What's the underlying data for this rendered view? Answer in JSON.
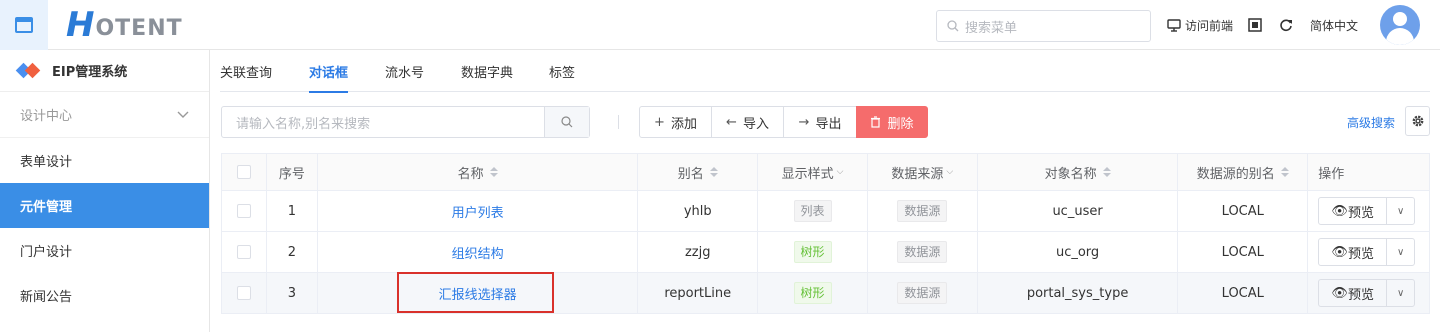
{
  "header": {
    "logo_h": "H",
    "logo_rest": "OTENT",
    "search_placeholder": "搜索菜单",
    "visit_frontend": "访问前端",
    "language": "简体中文"
  },
  "sidebar": {
    "system_title": "EIP管理系统",
    "group_label": "设计中心",
    "items": [
      {
        "label": "表单设计",
        "active": false
      },
      {
        "label": "元件管理",
        "active": true
      },
      {
        "label": "门户设计",
        "active": false
      },
      {
        "label": "新闻公告",
        "active": false
      }
    ]
  },
  "tabs": [
    {
      "label": "关联查询",
      "active": false
    },
    {
      "label": "对话框",
      "active": true
    },
    {
      "label": "流水号",
      "active": false
    },
    {
      "label": "数据字典",
      "active": false
    },
    {
      "label": "标签",
      "active": false
    }
  ],
  "toolbar": {
    "search_placeholder": "请输入名称,别名来搜索",
    "add_label": "添加",
    "import_label": "导入",
    "export_label": "导出",
    "delete_label": "删除",
    "advanced_search": "高级搜索"
  },
  "table": {
    "columns": {
      "no": "序号",
      "name": "名称",
      "alias": "别名",
      "style": "显示样式",
      "source": "数据来源",
      "object": "对象名称",
      "source_alias": "数据源的别名",
      "operation": "操作"
    },
    "rows": [
      {
        "no": "1",
        "name": "用户列表",
        "alias": "yhlb",
        "style": "列表",
        "source": "数据源",
        "object": "uc_user",
        "source_alias": "LOCAL",
        "action": "预览"
      },
      {
        "no": "2",
        "name": "组织结构",
        "alias": "zzjg",
        "style": "树形",
        "source": "数据源",
        "object": "uc_org",
        "source_alias": "LOCAL",
        "action": "预览"
      },
      {
        "no": "3",
        "name": "汇报线选择器",
        "alias": "reportLine",
        "style": "树形",
        "source": "数据源",
        "object": "portal_sys_type",
        "source_alias": "LOCAL",
        "action": "预览"
      }
    ]
  },
  "colors": {
    "primary": "#2c7be5",
    "sidebar_active": "#3a8ee6",
    "danger": "#f56c6c",
    "highlight": "#d9312b"
  }
}
